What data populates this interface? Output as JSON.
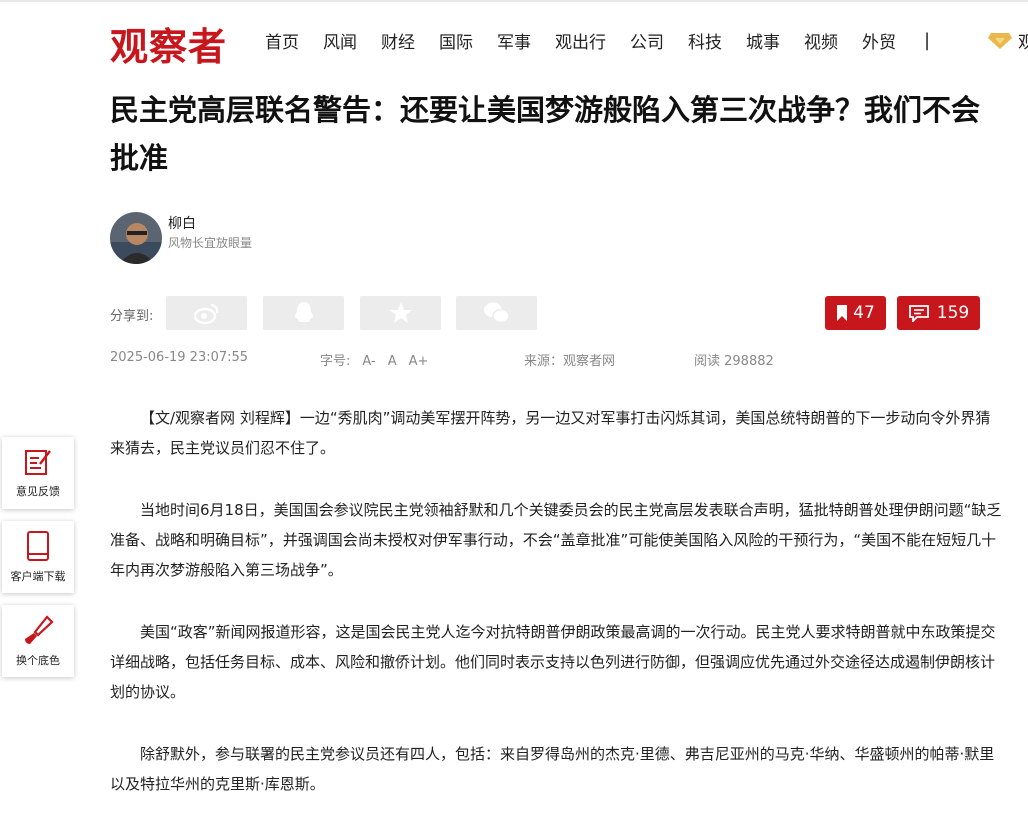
{
  "site": {
    "logo": "观察者"
  },
  "nav": {
    "items": [
      "首页",
      "风闻",
      "财经",
      "国际",
      "军事",
      "观出行",
      "公司",
      "科技",
      "城事",
      "视频",
      "外贸"
    ],
    "separator": "|",
    "vip_label": "观"
  },
  "article": {
    "title": "民主党高层联名警告：还要让美国梦游般陷入第三次战争？我们不会批准",
    "author": {
      "name": "柳白",
      "description": "风物长宜放眼量"
    },
    "share_label": "分享到:",
    "share_icons": [
      "weibo-icon",
      "qq-icon",
      "qzone-icon",
      "wechat-icon"
    ],
    "bookmark_count": "47",
    "comment_count": "159",
    "date": "2025-06-19 23:07:55",
    "font_size_label": "字号:",
    "font_sizes": [
      "A-",
      "A",
      "A+"
    ],
    "source": "来源：观察者网",
    "reads": "阅读 298882",
    "paragraphs": [
      "【文/观察者网 刘程辉】一边“秀肌肉”调动美军摆开阵势，另一边又对军事打击闪烁其词，美国总统特朗普的下一步动向令外界猜来猜去，民主党议员们忍不住了。",
      "当地时间6月18日，美国国会参议院民主党领袖舒默和几个关键委员会的民主党高层发表联合声明，猛批特朗普处理伊朗问题“缺乏准备、战略和明确目标”，并强调国会尚未授权对伊军事行动，不会“盖章批准”可能使美国陷入风险的干预行为，“美国不能在短短几十年内再次梦游般陷入第三场战争”。",
      "美国“政客”新闻网报道形容，这是国会民主党人迄今对抗特朗普伊朗政策最高调的一次行动。民主党人要求特朗普就中东政策提交详细战略，包括任务目标、成本、风险和撤侨计划。他们同时表示支持以色列进行防御，但强调应优先通过外交途径达成遏制伊朗核计划的协议。",
      "除舒默外，参与联署的民主党参议员还有四人，包括：来自罗得岛州的杰克·里德、弗吉尼亚州的马克·华纳、华盛顿州的帕蒂·默里以及特拉华州的克里斯·库恩斯。"
    ]
  },
  "sidebar": {
    "feedback": "意见反馈",
    "download": "客户端下载",
    "theme": "换个底色"
  },
  "colors": {
    "brand": "#c8161d",
    "muted": "#888888",
    "share_bg": "#ececec"
  }
}
